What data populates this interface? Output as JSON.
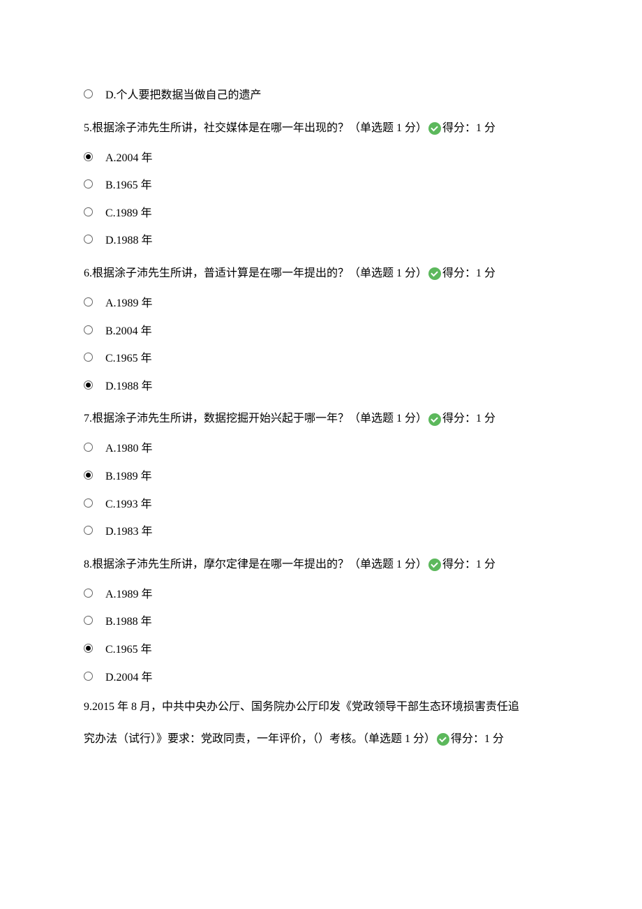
{
  "orphan_option": {
    "label": "D.个人要把数据当做自己的遗产",
    "selected": false
  },
  "questions": [
    {
      "num": "5",
      "prompt": "根据涂子沛先生所讲，社交媒体是在哪一年出现的？",
      "meta": "（单选题 1 分）",
      "score": "得分：1 分",
      "options": [
        {
          "label": "A.2004 年",
          "selected": true
        },
        {
          "label": "B.1965 年",
          "selected": false
        },
        {
          "label": "C.1989 年",
          "selected": false
        },
        {
          "label": "D.1988 年",
          "selected": false
        }
      ]
    },
    {
      "num": "6",
      "prompt": "根据涂子沛先生所讲，普适计算是在哪一年提出的？",
      "meta": "（单选题 1 分）",
      "score": "得分：1 分",
      "options": [
        {
          "label": "A.1989 年",
          "selected": false
        },
        {
          "label": "B.2004 年",
          "selected": false
        },
        {
          "label": "C.1965 年",
          "selected": false
        },
        {
          "label": "D.1988 年",
          "selected": true
        }
      ]
    },
    {
      "num": "7",
      "prompt": "根据涂子沛先生所讲，数据挖掘开始兴起于哪一年？",
      "meta": "（单选题 1 分）",
      "score": "得分：1 分",
      "options": [
        {
          "label": "A.1980 年",
          "selected": false
        },
        {
          "label": "B.1989 年",
          "selected": true
        },
        {
          "label": "C.1993 年",
          "selected": false
        },
        {
          "label": "D.1983 年",
          "selected": false
        }
      ]
    },
    {
      "num": "8",
      "prompt": "根据涂子沛先生所讲，摩尔定律是在哪一年提出的？",
      "meta": "（单选题 1 分）",
      "score": "得分：1 分",
      "options": [
        {
          "label": "A.1989 年",
          "selected": false
        },
        {
          "label": "B.1988 年",
          "selected": false
        },
        {
          "label": "C.1965 年",
          "selected": true
        },
        {
          "label": "D.2004 年",
          "selected": false
        }
      ]
    }
  ],
  "q9": {
    "line1": "9.2015 年 8 月，中共中央办公厅、国务院办公厅印发《党政领导干部生态环境损害责任追",
    "line2_a": "究办法（试行）》要求：党政同责，一年评价，（）考核。",
    "line2_meta": "（单选题 1 分）",
    "line2_score": "得分：1 分"
  }
}
